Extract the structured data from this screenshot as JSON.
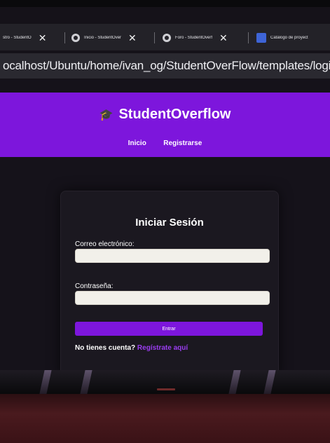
{
  "browser": {
    "tabs": [
      {
        "title": "stro - StudentO",
        "icon": "globe-icon"
      },
      {
        "title": "Inicio - StudentOver",
        "icon": "globe-icon"
      },
      {
        "title": "Foro - StudentOverf",
        "icon": "globe-icon"
      },
      {
        "title": "Catálogo de proyect",
        "icon": "app-icon"
      }
    ],
    "close_glyph": "✕",
    "url": "ocalhost/Ubuntu/home/ivan_og/StudentOverFlow/templates/login.html"
  },
  "site": {
    "brand": "StudentOverflow",
    "brand_icon": "graduation-cap-icon",
    "nav": [
      "Inicio",
      "Registrarse"
    ],
    "accent_color": "#7d16dc"
  },
  "login": {
    "title": "Iniciar Sesión",
    "email_label": "Correo electrónico:",
    "email_value": "",
    "password_label": "Contraseña:",
    "password_value": "",
    "submit_label": "Entrar",
    "register_prompt": "No tienes cuenta?",
    "register_link": "Regístrate aquí"
  }
}
